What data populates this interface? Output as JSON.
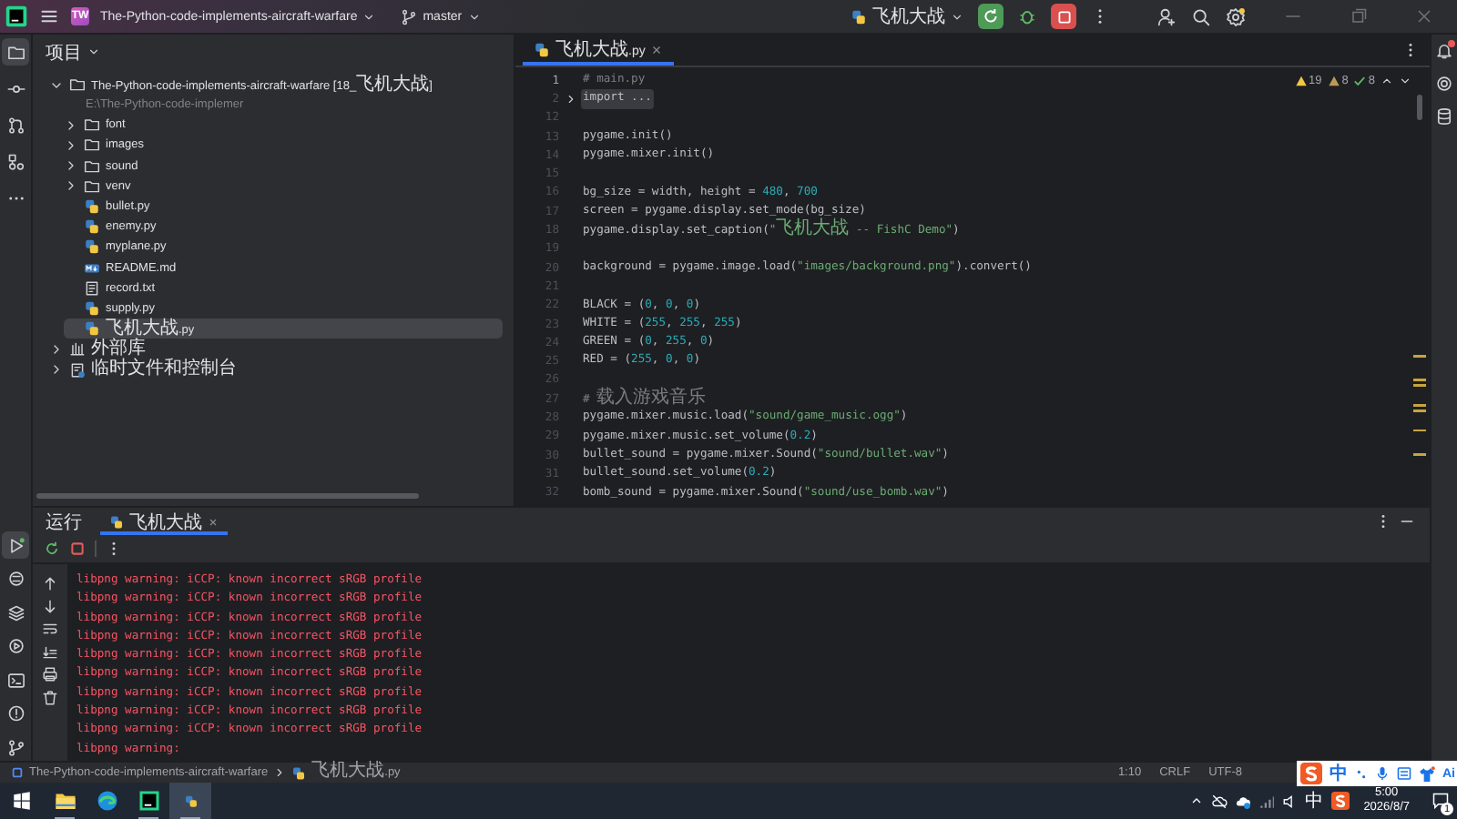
{
  "title_bar": {
    "project_badge": "TW",
    "project_name": "The-Python-code-implements-aircraft-warfare",
    "branch": "master",
    "run_config": "飞机大战"
  },
  "left_toolbar": {
    "top": [
      {
        "kind": "project",
        "selected": true
      },
      {
        "kind": "commit",
        "selected": false
      },
      {
        "kind": "pull_requests",
        "selected": false
      },
      {
        "kind": "structure",
        "selected": false
      },
      {
        "kind": "more",
        "selected": false
      }
    ],
    "bottom": [
      {
        "kind": "run",
        "selected": true
      },
      {
        "kind": "packages",
        "selected": false
      },
      {
        "kind": "layers",
        "selected": false
      },
      {
        "kind": "services",
        "selected": false
      },
      {
        "kind": "terminal",
        "selected": false
      },
      {
        "kind": "problems",
        "selected": false
      },
      {
        "kind": "git",
        "selected": false
      }
    ]
  },
  "project_panel": {
    "title": "项目",
    "tree": [
      {
        "label": "The-Python-code-implements-aircraft-warfare [18_飞机大战]",
        "path": "E:\\The-Python-code-implemer",
        "kind": "project",
        "expanded": true,
        "selected": false,
        "children": [
          {
            "label": "font",
            "kind": "folder",
            "expanded": false,
            "selected": false
          },
          {
            "label": "images",
            "kind": "folder",
            "expanded": false,
            "selected": false
          },
          {
            "label": "sound",
            "kind": "folder",
            "expanded": false,
            "selected": false
          },
          {
            "label": "venv",
            "kind": "folder",
            "expanded": false,
            "selected": false
          },
          {
            "label": "bullet.py",
            "kind": "python",
            "selected": false
          },
          {
            "label": "enemy.py",
            "kind": "python",
            "selected": false
          },
          {
            "label": "myplane.py",
            "kind": "python",
            "selected": false
          },
          {
            "label": "README.md",
            "kind": "markdown",
            "selected": false
          },
          {
            "label": "record.txt",
            "kind": "text",
            "selected": false
          },
          {
            "label": "supply.py",
            "kind": "python",
            "selected": false
          },
          {
            "label": "飞机大战.py",
            "kind": "python",
            "selected": true
          }
        ]
      },
      {
        "label": "外部库",
        "kind": "library",
        "expanded": false,
        "selected": false
      },
      {
        "label": "临时文件和控制台",
        "kind": "scratch",
        "expanded": false,
        "selected": false
      }
    ]
  },
  "editor": {
    "tabs": [
      {
        "label": "飞机大战.py",
        "selected": true
      }
    ],
    "inspections": {
      "warnings": "19",
      "weak_warnings": "8",
      "ok": "8"
    },
    "lines": [
      {
        "num": "1",
        "current": true,
        "segments": [
          {
            "t": "# main.py",
            "kind": "comment"
          }
        ]
      },
      {
        "num": "2",
        "current": false,
        "folded": true,
        "segments": [
          {
            "t": "import ...",
            "kind": "plain"
          }
        ]
      },
      {
        "num": "12",
        "current": false
      },
      {
        "num": "13",
        "current": false,
        "segments": [
          {
            "t": "pygame.init()",
            "kind": "plain"
          }
        ]
      },
      {
        "num": "14",
        "current": false,
        "segments": [
          {
            "t": "pygame.mixer.init()",
            "kind": "plain"
          }
        ]
      },
      {
        "num": "15",
        "current": false
      },
      {
        "num": "16",
        "current": false,
        "segments": [
          {
            "t": "bg_size = width, height = ",
            "kind": "plain"
          },
          {
            "t": "480",
            "kind": "number"
          },
          {
            "t": ", ",
            "kind": "plain"
          },
          {
            "t": "700",
            "kind": "number"
          }
        ]
      },
      {
        "num": "17",
        "current": false,
        "segments": [
          {
            "t": "screen = pygame.display.set_mode(bg_size)",
            "kind": "plain"
          }
        ]
      },
      {
        "num": "18",
        "current": false,
        "segments": [
          {
            "t": "pygame.display.set_caption(",
            "kind": "plain"
          },
          {
            "t": "\"飞机大战 -- FishC Demo\"",
            "kind": "string"
          },
          {
            "t": ")",
            "kind": "plain"
          }
        ]
      },
      {
        "num": "19",
        "current": false
      },
      {
        "num": "20",
        "current": false,
        "segments": [
          {
            "t": "background = pygame.image.load(",
            "kind": "plain"
          },
          {
            "t": "\"images/background.png\"",
            "kind": "string"
          },
          {
            "t": ").convert()",
            "kind": "plain"
          }
        ]
      },
      {
        "num": "21",
        "current": false
      },
      {
        "num": "22",
        "current": false,
        "segments": [
          {
            "t": "BLACK = (",
            "kind": "plain"
          },
          {
            "t": "0",
            "kind": "number"
          },
          {
            "t": ", ",
            "kind": "plain"
          },
          {
            "t": "0",
            "kind": "number"
          },
          {
            "t": ", ",
            "kind": "plain"
          },
          {
            "t": "0",
            "kind": "number"
          },
          {
            "t": ")",
            "kind": "plain"
          }
        ]
      },
      {
        "num": "23",
        "current": false,
        "segments": [
          {
            "t": "WHITE = (",
            "kind": "plain"
          },
          {
            "t": "255",
            "kind": "number"
          },
          {
            "t": ", ",
            "kind": "plain"
          },
          {
            "t": "255",
            "kind": "number"
          },
          {
            "t": ", ",
            "kind": "plain"
          },
          {
            "t": "255",
            "kind": "number"
          },
          {
            "t": ")",
            "kind": "plain"
          }
        ]
      },
      {
        "num": "24",
        "current": false,
        "segments": [
          {
            "t": "GREEN = (",
            "kind": "plain"
          },
          {
            "t": "0",
            "kind": "number"
          },
          {
            "t": ", ",
            "kind": "plain"
          },
          {
            "t": "255",
            "kind": "number"
          },
          {
            "t": ", ",
            "kind": "plain"
          },
          {
            "t": "0",
            "kind": "number"
          },
          {
            "t": ")",
            "kind": "plain"
          }
        ]
      },
      {
        "num": "25",
        "current": false,
        "segments": [
          {
            "t": "RED = (",
            "kind": "plain"
          },
          {
            "t": "255",
            "kind": "number"
          },
          {
            "t": ", ",
            "kind": "plain"
          },
          {
            "t": "0",
            "kind": "number"
          },
          {
            "t": ", ",
            "kind": "plain"
          },
          {
            "t": "0",
            "kind": "number"
          },
          {
            "t": ")",
            "kind": "plain"
          }
        ]
      },
      {
        "num": "26",
        "current": false
      },
      {
        "num": "27",
        "current": false,
        "segments": [
          {
            "t": "# 载入游戏音乐",
            "kind": "comment"
          }
        ]
      },
      {
        "num": "28",
        "current": false,
        "segments": [
          {
            "t": "pygame.mixer.music.load(",
            "kind": "plain"
          },
          {
            "t": "\"sound/game_music.ogg\"",
            "kind": "string"
          },
          {
            "t": ")",
            "kind": "plain"
          }
        ]
      },
      {
        "num": "29",
        "current": false,
        "segments": [
          {
            "t": "pygame.mixer.music.set_volume(",
            "kind": "plain"
          },
          {
            "t": "0.2",
            "kind": "number"
          },
          {
            "t": ")",
            "kind": "plain"
          }
        ]
      },
      {
        "num": "30",
        "current": false,
        "segments": [
          {
            "t": "bullet_sound = pygame.mixer.Sound(",
            "kind": "plain"
          },
          {
            "t": "\"sound/bullet.wav\"",
            "kind": "string"
          },
          {
            "t": ")",
            "kind": "plain"
          }
        ]
      },
      {
        "num": "31",
        "current": false,
        "segments": [
          {
            "t": "bullet_sound.set_volume(",
            "kind": "plain"
          },
          {
            "t": "0.2",
            "kind": "number"
          },
          {
            "t": ")",
            "kind": "plain"
          }
        ]
      },
      {
        "num": "32",
        "current": false,
        "segments": [
          {
            "t": "bomb_sound = pygame.mixer.Sound(",
            "kind": "plain"
          },
          {
            "t": "\"sound/use_bomb.wav\"",
            "kind": "string"
          },
          {
            "t": ")",
            "kind": "plain"
          }
        ]
      }
    ]
  },
  "right_toolbar": [
    {
      "kind": "notifications",
      "unread": true
    },
    {
      "kind": "assistant",
      "unread": false
    },
    {
      "kind": "database",
      "unread": false
    }
  ],
  "run_panel": {
    "title": "运行",
    "tabs": [
      {
        "label": "飞机大战",
        "selected": true
      }
    ],
    "output": [
      "libpng warning: iCCP: known incorrect sRGB profile",
      "libpng warning: iCCP: known incorrect sRGB profile",
      "libpng warning: iCCP: known incorrect sRGB profile",
      "libpng warning: iCCP: known incorrect sRGB profile",
      "libpng warning: iCCP: known incorrect sRGB profile",
      "libpng warning: iCCP: known incorrect sRGB profile",
      "libpng warning: iCCP: known incorrect sRGB profile",
      "libpng warning: iCCP: known incorrect sRGB profile",
      "libpng warning: iCCP: known incorrect sRGB profile",
      "libpng warning:"
    ]
  },
  "status_bar": {
    "breadcrumbs": [
      {
        "label": "The-Python-code-implements-aircraft-warfare",
        "kind": "project"
      },
      {
        "label": "飞机大战.py",
        "kind": "python"
      }
    ],
    "position": "1:10",
    "line_separator": "CRLF",
    "encoding": "UTF-8"
  },
  "ime_bar": {
    "mode": "中",
    "ai": "Ai"
  },
  "taskbar": {
    "apps": [
      {
        "kind": "explorer",
        "running": true,
        "active": false
      },
      {
        "kind": "browser",
        "running": false,
        "active": false
      },
      {
        "kind": "ide",
        "running": true,
        "active": false
      },
      {
        "kind": "python",
        "running": true,
        "active": true
      }
    ],
    "tray": {
      "input_mode": "中",
      "time": "5:00",
      "date": "2026/8/7",
      "notifications": "1"
    }
  }
}
